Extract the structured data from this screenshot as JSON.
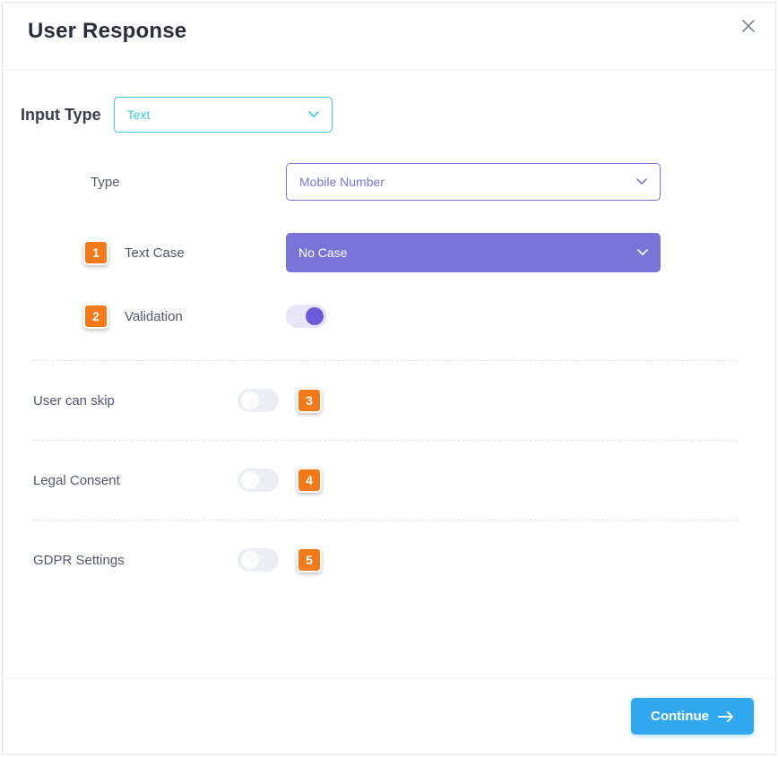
{
  "modal": {
    "title": "User Response"
  },
  "inputType": {
    "label": "Input Type",
    "value": "Text"
  },
  "type": {
    "label": "Type",
    "value": "Mobile Number"
  },
  "textCase": {
    "label": "Text Case",
    "value": "No Case",
    "badge": "1"
  },
  "validation": {
    "label": "Validation",
    "enabled": true,
    "badge": "2"
  },
  "options": {
    "skip": {
      "label": "User can skip",
      "enabled": false,
      "badge": "3"
    },
    "legal": {
      "label": "Legal Consent",
      "enabled": false,
      "badge": "4"
    },
    "gdpr": {
      "label": "GDPR Settings",
      "enabled": false,
      "badge": "5"
    }
  },
  "footer": {
    "continue": "Continue"
  }
}
